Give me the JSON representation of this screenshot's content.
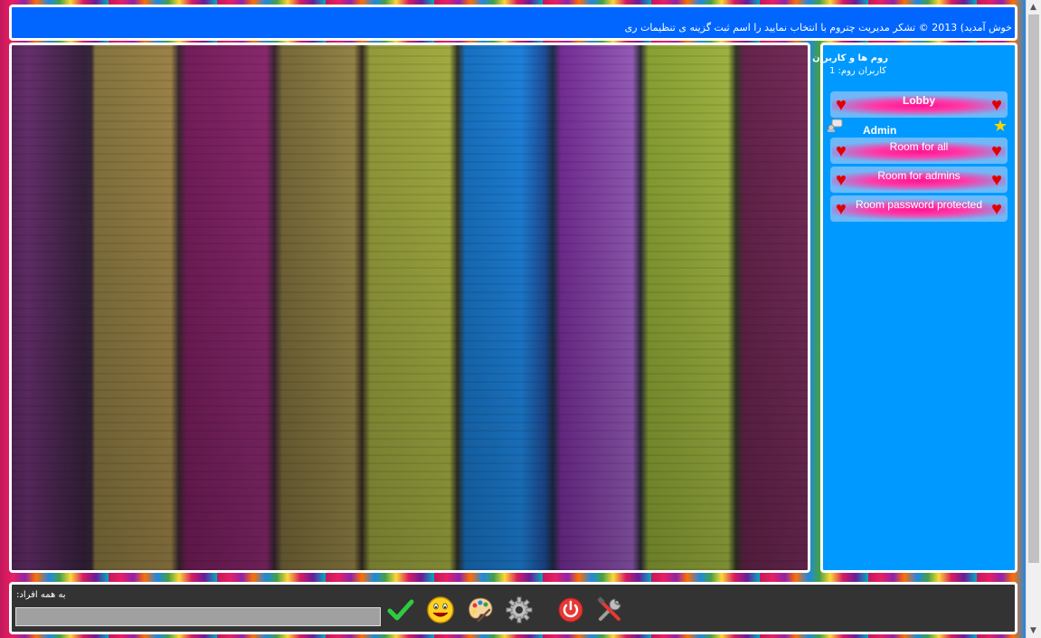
{
  "header": {
    "text": "خوش آمدید) 2013 © تشکر مدیریت چتروم با انتخاب نمایید را اسم ثبت گزینه ی تنظیمات ری"
  },
  "sidebar": {
    "title": "روم ها و کاربران",
    "count_label": "کاربران روم: 1",
    "rooms": [
      {
        "label": "Lobby"
      },
      {
        "label": "Room for all"
      },
      {
        "label": "Room for admins"
      },
      {
        "label": "Room password protected"
      }
    ],
    "user": {
      "name": "Admin"
    }
  },
  "footer": {
    "to_label": "به همه افراد:",
    "message_value": ""
  },
  "colors": {
    "header_bg": "#0066ff",
    "sidebar_bg": "#0099ff",
    "footer_bg": "#333333",
    "heart": "#e00000",
    "room_glow": "#ff1493"
  },
  "icons": {
    "room": "heart-icon",
    "user": "user-icon",
    "admin": "star-icon",
    "tools": [
      "send-icon",
      "smiley-icon",
      "palette-icon",
      "gear-icon",
      "power-icon",
      "tools-icon"
    ]
  }
}
